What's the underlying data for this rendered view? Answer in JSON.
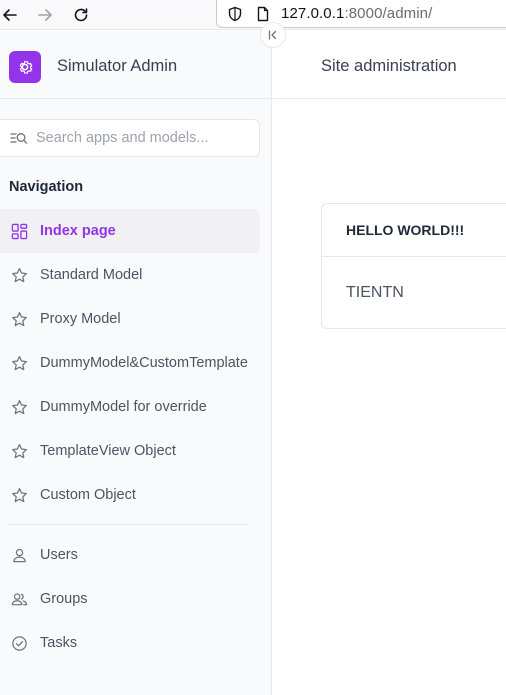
{
  "browser": {
    "url_host": "127.0.0.1",
    "url_rest": ":8000/admin/"
  },
  "sidebar": {
    "brand_title": "Simulator Admin",
    "search_placeholder": "Search apps and models...",
    "nav_heading": "Navigation",
    "items": [
      {
        "label": "Index page",
        "icon": "dashboard-icon",
        "active": true
      },
      {
        "label": "Standard Model",
        "icon": "star-icon"
      },
      {
        "label": "Proxy Model",
        "icon": "star-icon"
      },
      {
        "label": "DummyModel&CustomTemplate",
        "icon": "star-icon"
      },
      {
        "label": "DummyModel for override",
        "icon": "star-icon"
      },
      {
        "label": "TemplateView Object",
        "icon": "star-icon"
      },
      {
        "label": "Custom Object",
        "icon": "star-icon"
      }
    ],
    "auth_items": [
      {
        "label": "Users",
        "icon": "user-icon"
      },
      {
        "label": "Groups",
        "icon": "group-icon"
      },
      {
        "label": "Tasks",
        "icon": "check-circle-icon"
      }
    ]
  },
  "main": {
    "page_title": "Site administration",
    "card": {
      "title": "HELLO WORLD!!!",
      "body": "TIENTN"
    }
  },
  "colors": {
    "accent": "#9333ea",
    "sidebar_bg": "#f9fafb",
    "border": "#e5e7eb"
  }
}
